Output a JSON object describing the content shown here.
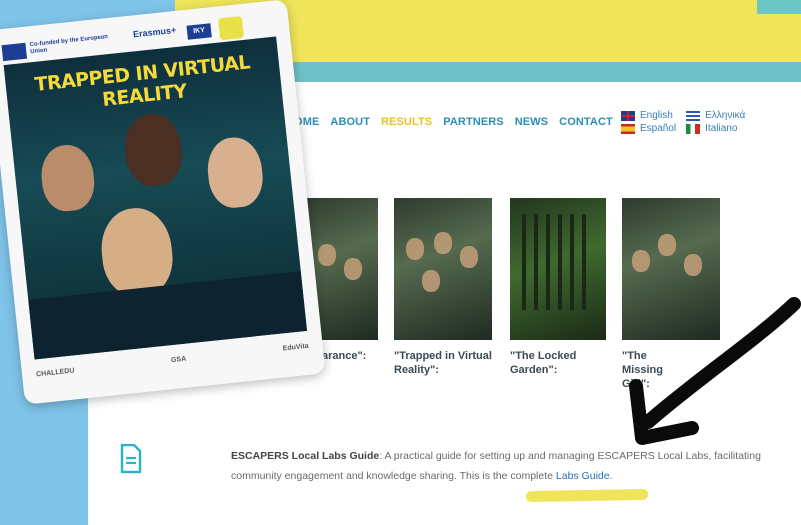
{
  "nav": {
    "items": [
      "HOME",
      "ABOUT",
      "RESULTS",
      "PARTNERS",
      "NEWS",
      "CONTACT"
    ],
    "active": "RESULTS"
  },
  "languages": [
    "English",
    "Ελληνικά",
    "Español",
    "Italiano"
  ],
  "poster": {
    "funded_by": "Co-funded by the European Union",
    "erasmus": "Erasmus+",
    "iky": "IKY",
    "title": "TRAPPED IN VIRTUAL REALITY",
    "partner_logos": [
      "CHALLEDU",
      "GSA",
      "EduVita"
    ]
  },
  "results": [
    {
      "caption": "arance\":"
    },
    {
      "caption": "\"Trapped in Virtual Reality\":"
    },
    {
      "caption": "\"The Locked Garden\":"
    },
    {
      "caption": "\"The Missing Girl\":"
    }
  ],
  "guide": {
    "title": "ESCAPERS Local Labs Guide",
    "text": ": A practical guide for setting up and managing ESCAPERS Local Labs, facilitating community engagement and knowledge sharing. This is the complete ",
    "link": "Labs Guide",
    "end": "."
  },
  "colors": {
    "yellow": "#efe45a",
    "teal": "#6fc0c8",
    "blue_bg": "#7ec3e8",
    "nav": "#2a8fb2",
    "active": "#e6c12b"
  }
}
